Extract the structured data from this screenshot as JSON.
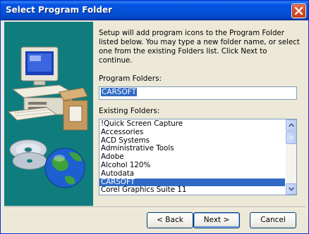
{
  "window": {
    "title": "Select Program Folder"
  },
  "description": "Setup will add program icons to the Program Folder listed below. You may type a new folder name, or select one from the existing Folders list.  Click Next to continue.",
  "program_folders": {
    "label": "Program Folders:",
    "value": "CARSOFT"
  },
  "existing_folders": {
    "label": "Existing Folders:",
    "items": [
      "!Quick Screen Capture",
      "Accessories",
      "ACD Systems",
      "Administrative Tools",
      "Adobe",
      "Alcohol 120%",
      "Autodata",
      "CARSOFT",
      "Corel Graphics Suite 11"
    ],
    "selected": "CARSOFT"
  },
  "buttons": {
    "back": "< Back",
    "next": "Next >",
    "cancel": "Cancel"
  },
  "icons": {
    "close": "close-icon",
    "computer": "computer-icon",
    "globe": "globe-icon",
    "cd": "cd-icon"
  },
  "colors": {
    "titlebar": "#0653e4",
    "art_panel": "#0f7d7d",
    "selection": "#316ac5",
    "close_button": "#d7502f"
  }
}
